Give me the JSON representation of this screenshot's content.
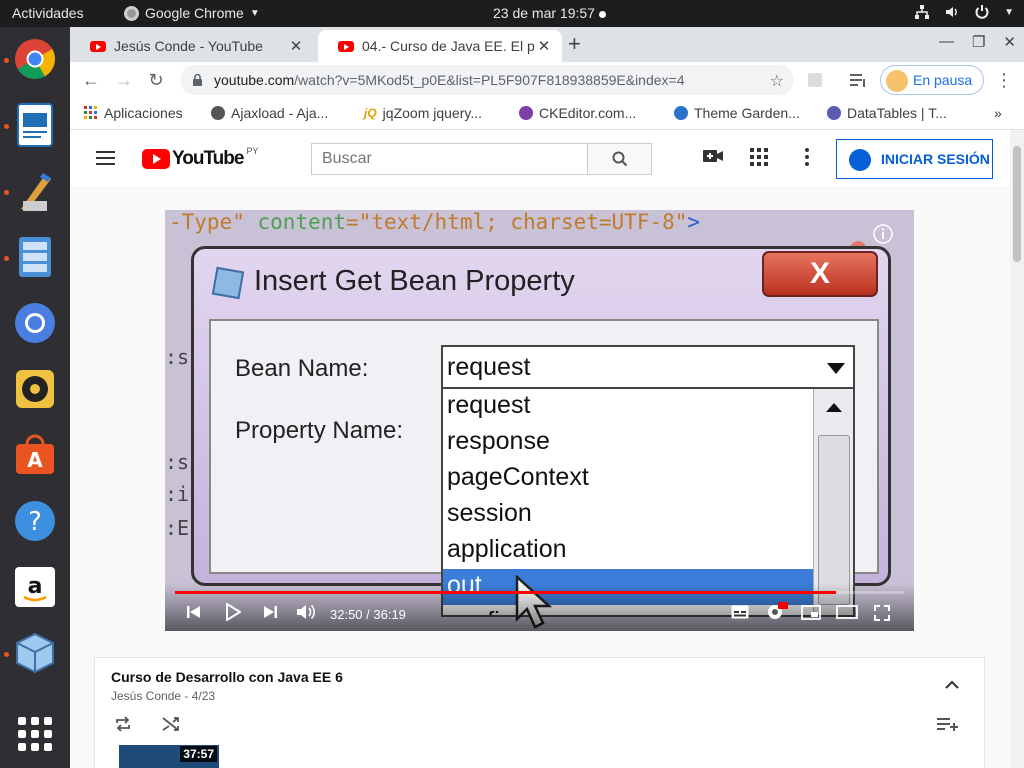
{
  "system": {
    "activities": "Actividades",
    "app_name": "Google Chrome",
    "clock": "23 de mar  19:57"
  },
  "browser": {
    "tabs": [
      {
        "title": "Jesús Conde - YouTube",
        "active": false
      },
      {
        "title": "04.- Curso de Java EE. El p",
        "active": true
      }
    ],
    "url_host": "youtube.com",
    "url_path": "/watch?v=5MKod5t_p0E&list=PL5F907F818938859E&index=4",
    "profile_label": "En pausa",
    "bookmarks": [
      "Aplicaciones",
      "Ajaxload - Aja...",
      "jqZoom jquery...",
      "CKEditor.com...",
      "Theme Garden...",
      "DataTables | T..."
    ]
  },
  "youtube": {
    "logo_text": "YouTube",
    "country_code": "PY",
    "search_placeholder": "Buscar",
    "signin_label": "INICIAR SESIÓN"
  },
  "video": {
    "code_line": {
      "attr": "-Type\" ",
      "kw": "content",
      "str": "=\"text/html; charset=UTF-8\"",
      "br": ">"
    },
    "dialog": {
      "title": "Insert Get Bean Property",
      "close": "X",
      "bean_name_label": "Bean Name:",
      "property_name_label": "Property Name:",
      "selected_bean": "request",
      "options": [
        "request",
        "response",
        "pageContext",
        "session",
        "application",
        "out",
        "config"
      ],
      "highlighted": "out"
    },
    "time_current": "32:50",
    "time_total": "36:19",
    "time_display": "32:50 / 36:19",
    "progress": 0.9063
  },
  "playlist": {
    "title": "Curso de Desarrollo con Java EE 6",
    "author": "Jesús Conde",
    "position": "4/23",
    "first_duration": "37:57"
  },
  "colors": {
    "youtube_red": "#ff0000",
    "signin_blue": "#065fd4",
    "chrome_blue": "#1a73e8",
    "ubuntu_orange": "#e95420"
  }
}
